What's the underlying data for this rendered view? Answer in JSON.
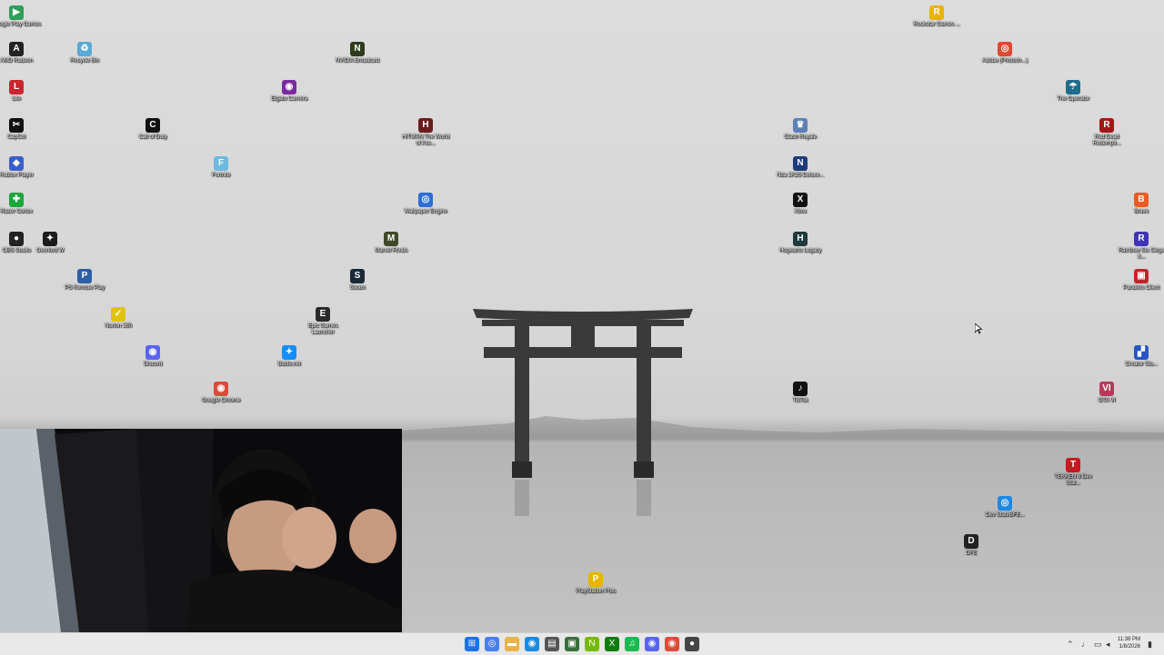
{
  "desktop_icons": [
    {
      "id": "google-play-games",
      "label": "Google Play Games",
      "glyph": "▶",
      "color": "#2e9f58"
    },
    {
      "id": "amd-radeon",
      "label": "AMD Radeon",
      "glyph": "A",
      "color": "#222222"
    },
    {
      "id": "recycle-bin",
      "label": "Recycle Bin",
      "glyph": "♻",
      "color": "#5aa9d6"
    },
    {
      "id": "nvidia-broadcast",
      "label": "NVIDIA Broadcast",
      "glyph": "N",
      "color": "#2d3b1c"
    },
    {
      "id": "rockstar-games",
      "label": "Rockstar Games ...",
      "glyph": "R",
      "color": "#e8b400"
    },
    {
      "id": "adobe-photoshop",
      "label": "Adobe (Photosh...)",
      "glyph": "◎",
      "color": "#e04a30"
    },
    {
      "id": "lite",
      "label": "Lite",
      "glyph": "L",
      "color": "#c8262e"
    },
    {
      "id": "elgato-camera",
      "label": "Elgato Camera",
      "glyph": "◉",
      "color": "#7a2aa0"
    },
    {
      "id": "the-operator",
      "label": "The Operator",
      "glyph": "☂",
      "color": "#1d6d8c"
    },
    {
      "id": "capcut",
      "label": "CapCut",
      "glyph": "✂",
      "color": "#111111"
    },
    {
      "id": "call-of-duty",
      "label": "Call of Duty",
      "glyph": "C",
      "color": "#111111"
    },
    {
      "id": "hitman-game",
      "label": "HITMAN The World of Ass...",
      "glyph": "H",
      "color": "#6b1c1c"
    },
    {
      "id": "clash-royale",
      "label": "Clash Royale",
      "glyph": "♛",
      "color": "#5d7fb6"
    },
    {
      "id": "red-dead",
      "label": "Red Dead Redempti...",
      "glyph": "R",
      "color": "#a01818"
    },
    {
      "id": "roblox-player",
      "label": "Roblox Player",
      "glyph": "◆",
      "color": "#3a5fcc"
    },
    {
      "id": "fortnite",
      "label": "Fortnite",
      "glyph": "F",
      "color": "#6bb9e0"
    },
    {
      "id": "nba-2k",
      "label": "Nba 2K25 Deluxe...",
      "glyph": "N",
      "color": "#1e3a7a"
    },
    {
      "id": "razer-cortex",
      "label": "Razer Cortex",
      "glyph": "✚",
      "color": "#1aa83b"
    },
    {
      "id": "wallpaper-engine",
      "label": "Wallpaper Engine",
      "glyph": "◎",
      "color": "#2d6ed8"
    },
    {
      "id": "xbox",
      "label": "Xbox",
      "glyph": "X",
      "color": "#111111"
    },
    {
      "id": "brave",
      "label": "Brave",
      "glyph": "B",
      "color": "#f15a24"
    },
    {
      "id": "obs-studio",
      "label": "OBS Studio",
      "glyph": "●",
      "color": "#222222"
    },
    {
      "id": "overlord-game",
      "label": "Overlord W",
      "glyph": "✦",
      "color": "#1c1c1c"
    },
    {
      "id": "marvel-rivals",
      "label": "Marvel Rivals",
      "glyph": "M",
      "color": "#3e4a2a"
    },
    {
      "id": "hogwarts-legacy",
      "label": "Hogwarts Legacy",
      "glyph": "H",
      "color": "#1f3a3a"
    },
    {
      "id": "rainbow-six",
      "label": "Rainbow Six Siege X...",
      "glyph": "R",
      "color": "#4033b8"
    },
    {
      "id": "pc-remote-play",
      "label": "PS Remote Play",
      "glyph": "P",
      "color": "#2c5fa3"
    },
    {
      "id": "steam",
      "label": "Steam",
      "glyph": "S",
      "color": "#1b2838"
    },
    {
      "id": "parallels-client",
      "label": "Parallels Client",
      "glyph": "▣",
      "color": "#c3232b"
    },
    {
      "id": "norton-360",
      "label": "Norton 360",
      "glyph": "✓",
      "color": "#e0c30a"
    },
    {
      "id": "epic-games",
      "label": "Epic Games Launcher",
      "glyph": "E",
      "color": "#2a2a2a"
    },
    {
      "id": "discord",
      "label": "Discord",
      "glyph": "◉",
      "color": "#5865f2"
    },
    {
      "id": "battle-net",
      "label": "Battle.net",
      "glyph": "✦",
      "color": "#148eff"
    },
    {
      "id": "creator-studio",
      "label": "Creator Stu...",
      "glyph": "▞",
      "color": "#2656c4"
    },
    {
      "id": "google-chrome",
      "label": "Google Chrome",
      "glyph": "◉",
      "color": "#dd4b39"
    },
    {
      "id": "tiktok",
      "label": "TikTok",
      "glyph": "♪",
      "color": "#111111"
    },
    {
      "id": "gta-vi",
      "label": "GTA VI",
      "glyph": "VI",
      "color": "#b83a5a"
    },
    {
      "id": "tekken-8",
      "label": "TEKKEN 8 Dev Stat...",
      "glyph": "T",
      "color": "#c8181f"
    },
    {
      "id": "edge-stuff",
      "label": "Dev StateBFE...",
      "glyph": "◎",
      "color": "#1e88e5"
    },
    {
      "id": "dota",
      "label": "DFE",
      "glyph": "D",
      "color": "#222222"
    },
    {
      "id": "playstation-plus",
      "label": "PlayStation Plus",
      "glyph": "P",
      "color": "#e8b400"
    }
  ],
  "taskbar": {
    "apps": [
      {
        "id": "start",
        "glyph": "⊞",
        "color": "#1a73e8"
      },
      {
        "id": "copilot",
        "glyph": "◎",
        "color": "#4a7ff0"
      },
      {
        "id": "file-explorer",
        "glyph": "▬",
        "color": "#e8b34a"
      },
      {
        "id": "edge",
        "glyph": "◉",
        "color": "#1c8be0"
      },
      {
        "id": "microsoft-store",
        "glyph": "▤",
        "color": "#555555"
      },
      {
        "id": "camera-app",
        "glyph": "▣",
        "color": "#3b6e3b"
      },
      {
        "id": "nvidia",
        "glyph": "N",
        "color": "#76b900"
      },
      {
        "id": "xbox-app",
        "glyph": "X",
        "color": "#107c10"
      },
      {
        "id": "spotify",
        "glyph": "♫",
        "color": "#1db954"
      },
      {
        "id": "discord-app",
        "glyph": "◉",
        "color": "#5865f2"
      },
      {
        "id": "chrome-app",
        "glyph": "◉",
        "color": "#dd4b39"
      },
      {
        "id": "obs-app",
        "glyph": "●",
        "color": "#444444"
      }
    ],
    "clock_time": "11:38 PM",
    "clock_date": "1/8/2026"
  }
}
